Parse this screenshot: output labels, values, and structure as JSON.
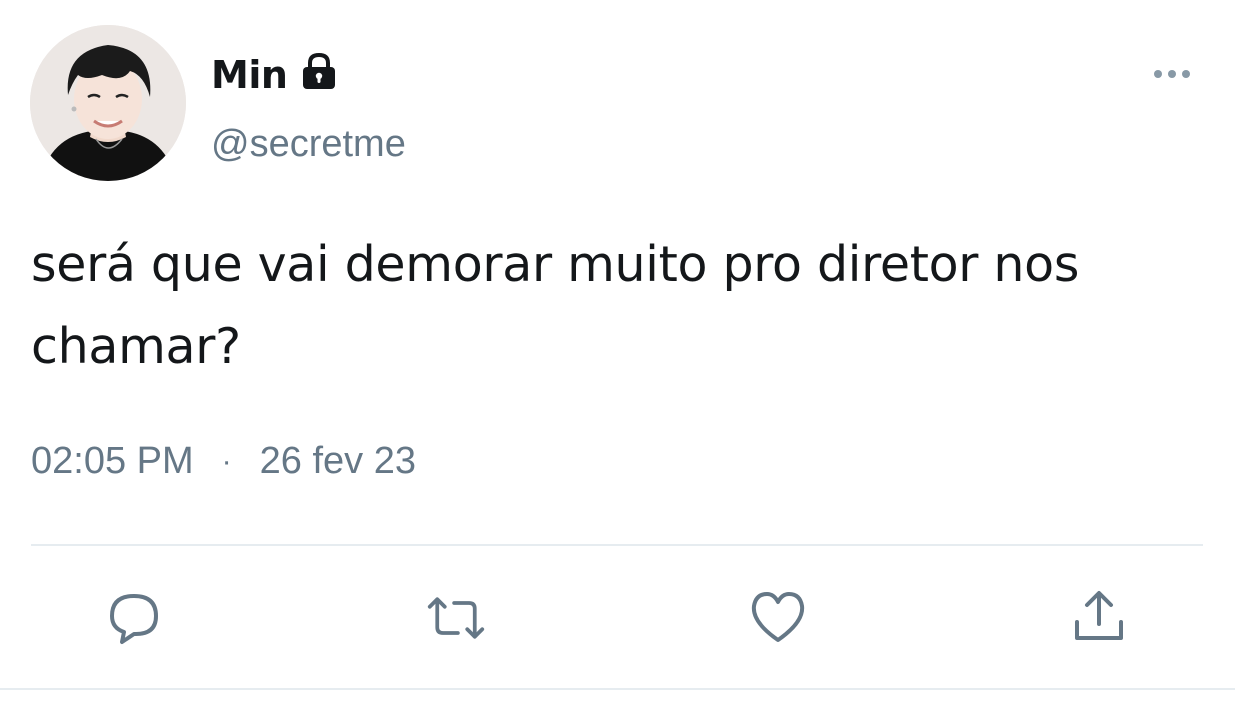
{
  "tweet": {
    "display_name": "Min",
    "handle": "@secretme",
    "text_line1": "será que vai demorar muito pro diretor nos",
    "text_line2": "chamar?",
    "time": "02:05 PM",
    "separator": "·",
    "date": "26 fev 23"
  },
  "icons": {
    "lock": "lock-icon",
    "more": "more-options-icon",
    "reply": "reply-icon",
    "retweet": "retweet-icon",
    "like": "heart-icon",
    "share": "share-icon"
  },
  "colors": {
    "text_primary": "#14171a",
    "text_secondary": "#657786",
    "divider": "#e6ecf0"
  }
}
